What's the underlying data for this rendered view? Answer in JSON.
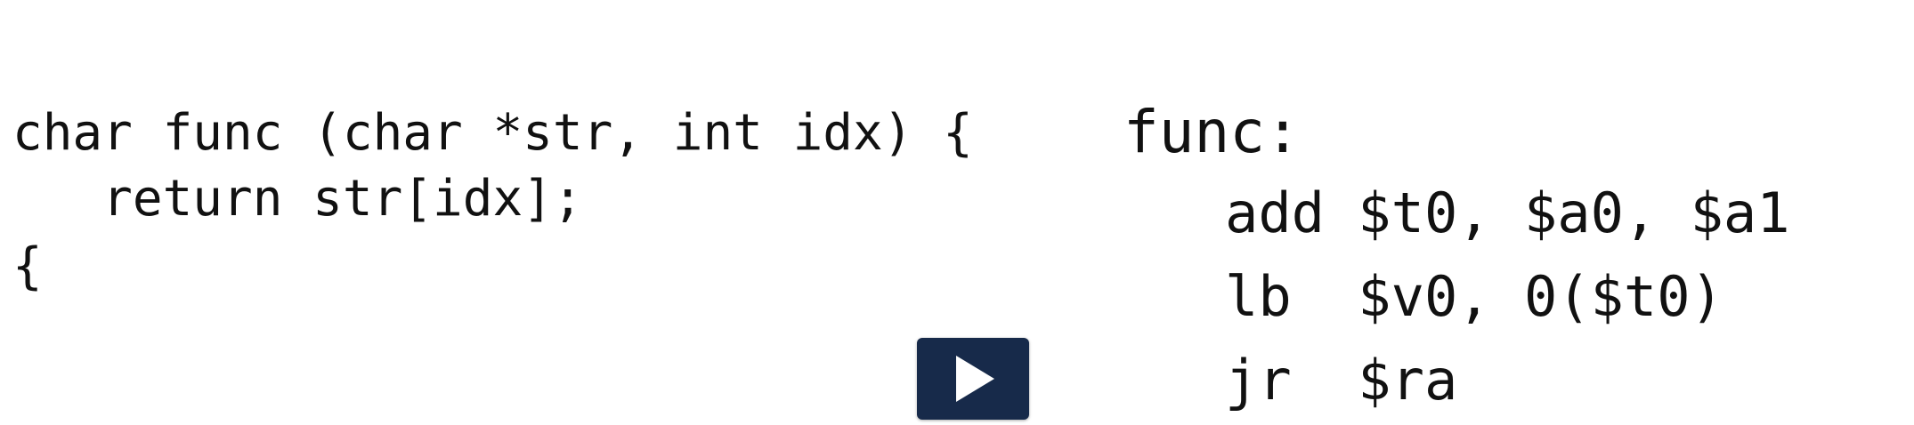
{
  "c_source": {
    "lines": [
      "char func (char *str, int idx) {",
      "   return str[idx];",
      "{"
    ]
  },
  "assembly": {
    "label": "func:",
    "instructions": [
      "add $t0, $a0, $a1",
      "lb  $v0, 0($t0)",
      "jr  $ra"
    ]
  },
  "player": {
    "play_icon": "play-icon",
    "button_color": "#172a4a"
  }
}
